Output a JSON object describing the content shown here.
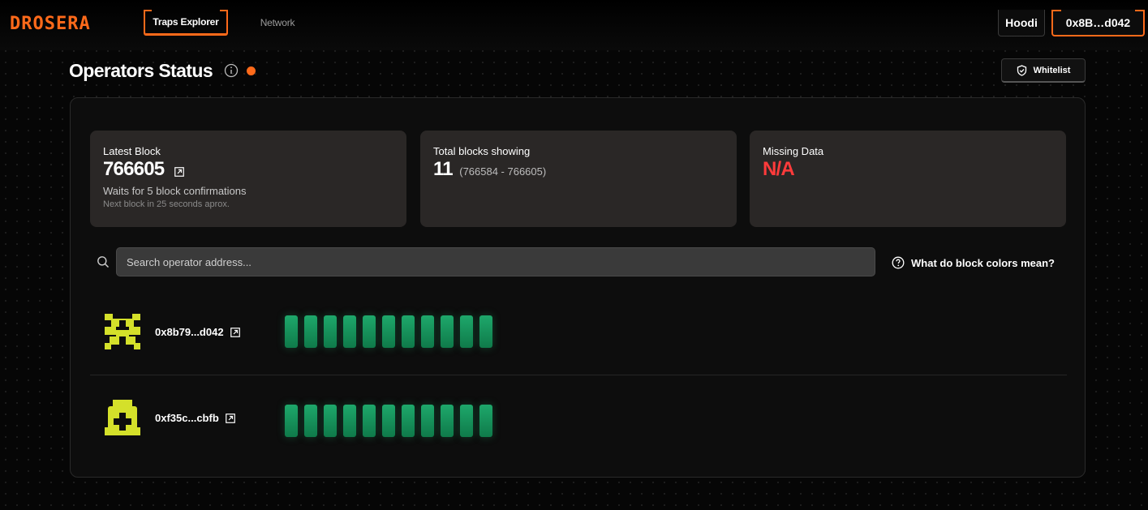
{
  "app": {
    "brand": "DROSERA"
  },
  "nav": {
    "tabs": [
      {
        "label": "Traps Explorer",
        "active": true
      },
      {
        "label": "Network",
        "active": false
      }
    ]
  },
  "header": {
    "network_label": "Hoodi",
    "wallet_label": "0x8B…d042"
  },
  "page": {
    "title": "Operators Status",
    "whitelist_label": "Whitelist"
  },
  "stats": {
    "latest_block": {
      "label": "Latest Block",
      "value": "766605",
      "sub": "Waits for 5 block confirmations",
      "sub2": "Next block in 25 seconds aprox."
    },
    "total_blocks": {
      "label": "Total blocks showing",
      "value": "11",
      "range": "(766584 - 766605)"
    },
    "missing_data": {
      "label": "Missing Data",
      "value": "N/A"
    }
  },
  "search": {
    "placeholder": "Search operator address..."
  },
  "help": {
    "label": "What do block colors mean?"
  },
  "operators": [
    {
      "address": "0x8b79...d042",
      "blocks": 11,
      "block_status": "confirmed"
    },
    {
      "address": "0xf35c...cbfb",
      "blocks": 11,
      "block_status": "confirmed"
    }
  ],
  "colors": {
    "accent": "#ff6a1a",
    "block_ok": "#1ea86b",
    "missing": "#ff3b3b",
    "avatar": "#d4e02a"
  }
}
